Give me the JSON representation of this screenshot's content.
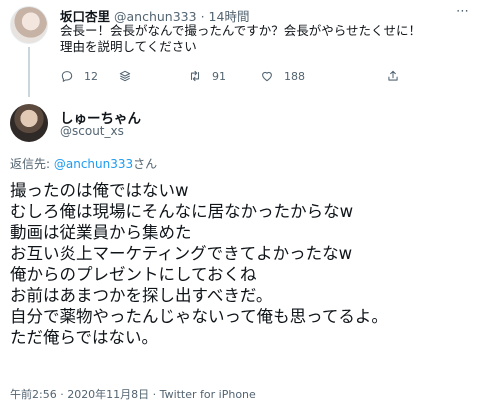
{
  "parent_tweet": {
    "name": "坂口杏里",
    "handle": "@anchun333",
    "separator": "·",
    "time": "14時間",
    "more_icon": "⋯",
    "lines": [
      "会長ー！会長がなんで撮ったんですか？会長がやらせたくせに！",
      "理由を説明してください"
    ],
    "actions": {
      "reply_count": "12",
      "retweet_count": "91",
      "like_count": "188"
    }
  },
  "main_tweet": {
    "name": "しゅーちゃん",
    "handle": "@scout_xs",
    "reply_prefix": "返信先: ",
    "reply_mention": "@anchun333",
    "reply_suffix": "さん",
    "lines": [
      "撮ったのは俺ではないw",
      "むしろ俺は現場にそんなに居なかったからなw",
      "動画は従業員から集めた",
      "お互い炎上マーケティングできてよかったなw",
      "俺からのプレゼントにしておくね",
      "お前はあまつかを探し出すべきだ。",
      "自分で薬物やったんじゃないって俺も思ってるよ。",
      "ただ俺らではない。"
    ],
    "meta": "午前2:56 · 2020年11月8日 · Twitter for iPhone"
  },
  "colors": {
    "text": "#0f1419",
    "secondary": "#536471",
    "link": "#1d9bf0",
    "thread_line": "#ccd6dd"
  }
}
